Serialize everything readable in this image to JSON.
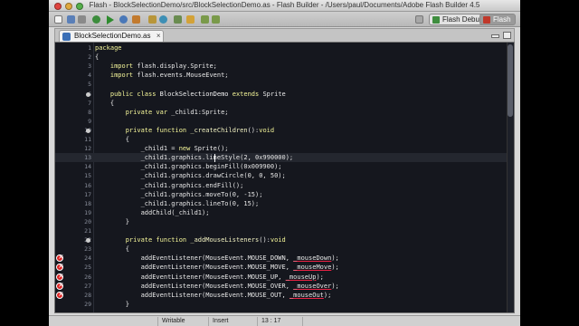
{
  "window": {
    "title": "Flash - BlockSelectionDemo/src/BlockSelectionDemo.as - Flash Builder - /Users/paul/Documents/Adobe Flash Builder 4.5"
  },
  "toolbar": {
    "perspectives": [
      {
        "label": "Flash Debug",
        "icon": "debug-perspective-icon",
        "active": false
      },
      {
        "label": "Flash",
        "icon": "flash-perspective-icon",
        "active": true
      }
    ]
  },
  "editor": {
    "tab_label": "BlockSelectionDemo.as",
    "lines": [
      {
        "num": "1",
        "html": "<span class=\"kw\">package</span>"
      },
      {
        "num": "2",
        "html": "{"
      },
      {
        "num": "3",
        "html": "    <span class=\"kw\">import</span> flash.display.Sprite;"
      },
      {
        "num": "4",
        "html": "    <span class=\"kw\">import</span> flash.events.MouseEvent;"
      },
      {
        "num": "5",
        "html": ""
      },
      {
        "num": "6",
        "fold": true,
        "html": "    <span class=\"kw\">public class</span> <span class=\"cls\">BlockSelectionDemo</span> <span class=\"kw\">extends</span> Sprite"
      },
      {
        "num": "7",
        "html": "    {"
      },
      {
        "num": "8",
        "html": "        <span class=\"kw\">private var</span> _child1:Sprite;"
      },
      {
        "num": "9",
        "html": ""
      },
      {
        "num": "10",
        "fold": true,
        "html": "        <span class=\"kw\">private function</span> <span class=\"fn\">_createChildren</span>():<span class=\"kw\">void</span>"
      },
      {
        "num": "11",
        "html": "        {"
      },
      {
        "num": "12",
        "html": "            _child1 = <span class=\"kw\">new</span> Sprite();"
      },
      {
        "num": "13",
        "current": true,
        "html": "            _child1.graphics.lineStyle(2, 0x990000);"
      },
      {
        "num": "14",
        "html": "            _child1.graphics.beginFill(0x009900);"
      },
      {
        "num": "15",
        "html": "            _child1.graphics.drawCircle(0, 0, 50);"
      },
      {
        "num": "16",
        "html": "            _child1.graphics.endFill();"
      },
      {
        "num": "17",
        "html": "            _child1.graphics.moveTo(0, -15);"
      },
      {
        "num": "18",
        "html": "            _child1.graphics.lineTo(0, 15);"
      },
      {
        "num": "19",
        "html": "            addChild(_child1);"
      },
      {
        "num": "20",
        "html": "        }"
      },
      {
        "num": "21",
        "html": ""
      },
      {
        "num": "22",
        "fold": true,
        "html": "        <span class=\"kw\">private function</span> <span class=\"fn\">_addMouseListeners</span>():<span class=\"kw\">void</span>"
      },
      {
        "num": "23",
        "html": "        {"
      },
      {
        "num": "24",
        "error": true,
        "html": "            addEventListener(MouseEvent.MOUSE_DOWN, <span class=\"ul\">_mouseDown</span>);"
      },
      {
        "num": "25",
        "error": true,
        "html": "            addEventListener(MouseEvent.MOUSE_MOVE, <span class=\"ul\">_mouseMove</span>);"
      },
      {
        "num": "26",
        "error": true,
        "html": "            addEventListener(MouseEvent.MOUSE_UP, <span class=\"ul\">_mouseUp</span>);"
      },
      {
        "num": "27",
        "error": true,
        "html": "            addEventListener(MouseEvent.MOUSE_OVER, <span class=\"ul\">_mouseOver</span>);"
      },
      {
        "num": "28",
        "error": true,
        "html": "            addEventListener(MouseEvent.MOUSE_OUT, <span class=\"ul\">_mouseOut</span>);"
      },
      {
        "num": "29",
        "html": "        }"
      }
    ]
  },
  "statusbar": {
    "mode": "Writable",
    "insert": "Insert",
    "position": "13 : 17"
  },
  "colors": {
    "editor_bg": "#15171e",
    "keyword": "#f6f79a",
    "error": "#dd2222"
  }
}
